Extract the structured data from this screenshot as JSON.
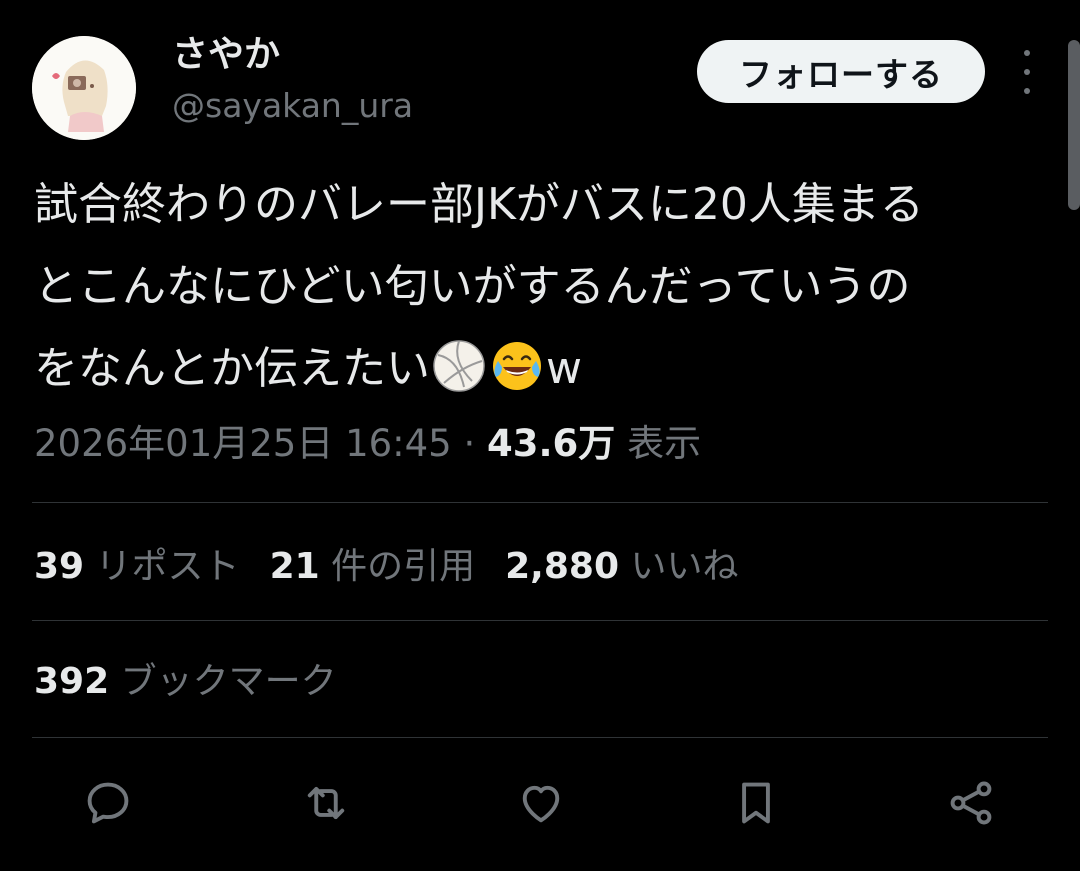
{
  "user": {
    "display_name": "さやか",
    "handle": "@sayakan_ura",
    "follow_label": "フォローする"
  },
  "tweet": {
    "line1": "試合終わりのバレー部JKがバスに20人集まる",
    "line2": "とこんなにひどい匂いがするんだっていうの",
    "line3_text": "をなんとか伝えたい",
    "line3_suffix": "w",
    "emojis": [
      "volleyball-emoji",
      "tears-of-joy-emoji"
    ],
    "timestamp": "2026年01月25日 16:45",
    "separator": " · ",
    "views_count": "43.6万",
    "views_label": " 表示"
  },
  "stats": {
    "reposts_count": "39",
    "reposts_label": " リポスト",
    "quotes_count": "21",
    "quotes_label": " 件の引用",
    "likes_count": "2,880",
    "likes_label": " いいね",
    "bookmarks_count": "392",
    "bookmarks_label": " ブックマーク"
  },
  "actions": [
    "reply-icon",
    "repost-icon",
    "like-icon",
    "bookmark-icon",
    "share-icon"
  ],
  "colors": {
    "background": "#000000",
    "text_primary": "#e7e9ea",
    "text_secondary": "#71767b",
    "divider": "#2f3336",
    "follow_button_bg": "#eff3f4"
  }
}
